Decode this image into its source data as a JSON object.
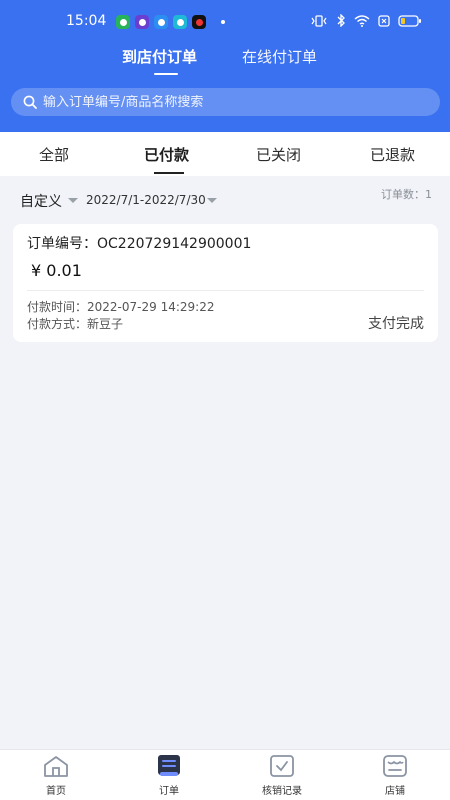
{
  "status_bar": {
    "time": "15:04",
    "app_colors": [
      "#27b35a",
      "#6a3fd0",
      "#2c8ef0",
      "#1fb9d6",
      "#111111"
    ]
  },
  "header": {
    "tabs": [
      {
        "label": "到店付订单",
        "active": true
      },
      {
        "label": "在线付订单",
        "active": false
      }
    ],
    "search_placeholder": "输入订单编号/商品名称搜索"
  },
  "status_tabs": [
    {
      "label": "全部",
      "active": false
    },
    {
      "label": "已付款",
      "active": true
    },
    {
      "label": "已关闭",
      "active": false
    },
    {
      "label": "已退款",
      "active": false
    }
  ],
  "filter": {
    "custom_label": "自定义",
    "date_range": "2022/7/1-2022/7/30",
    "order_count_label": "订单数：1"
  },
  "orders": [
    {
      "order_no_label": "订单编号：",
      "order_no": "OC220729142900001",
      "amount": "¥ 0.01",
      "pay_time_label": "付款时间：",
      "pay_time": "2022-07-29 14:29:22",
      "pay_method_label": "付款方式：",
      "pay_method": "新豆子",
      "status": "支付完成"
    }
  ],
  "bottom_nav": [
    {
      "label": "首页",
      "icon": "home-icon",
      "active": false
    },
    {
      "label": "订单",
      "icon": "order-icon",
      "active": true
    },
    {
      "label": "核销记录",
      "icon": "verify-record-icon",
      "active": false
    },
    {
      "label": "店铺",
      "icon": "store-icon",
      "active": false
    }
  ],
  "colors": {
    "primary": "#3a71f0",
    "background": "#f1f3f8"
  }
}
